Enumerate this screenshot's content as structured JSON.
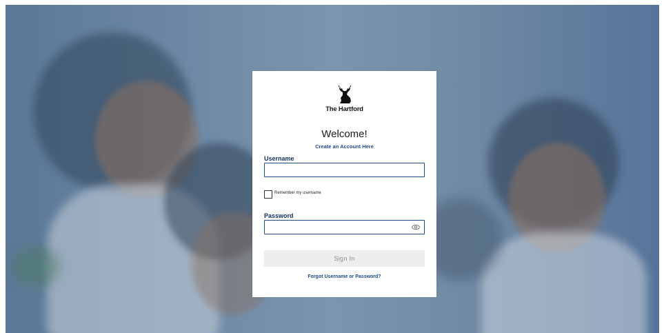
{
  "brand": {
    "name": "The Hartford",
    "logo_icon": "stag-logo-icon"
  },
  "login": {
    "title": "Welcome!",
    "create_account_link": "Create an Account Here",
    "username_label": "Username",
    "username_value": "",
    "remember_label": "Remember my username",
    "remember_checked": false,
    "password_label": "Password",
    "password_value": "",
    "show_password_icon": "eye-icon",
    "sign_in_label": "Sign In",
    "forgot_link": "Forgot Username or Password?"
  },
  "colors": {
    "link": "#1f4a8a",
    "label": "#0f2f5e",
    "button_bg": "#eeeeee",
    "button_text": "#8b8b8b",
    "overlay": "#5a7897"
  }
}
